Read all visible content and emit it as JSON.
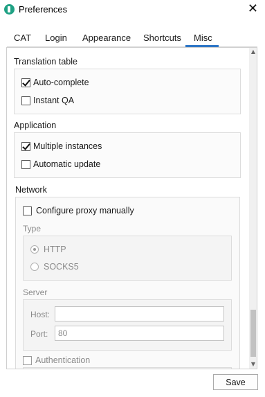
{
  "window": {
    "title": "Preferences",
    "close_glyph": "✕"
  },
  "tabs": [
    {
      "label": "CAT"
    },
    {
      "label": "Login"
    },
    {
      "label": "Appearance"
    },
    {
      "label": "Shortcuts"
    },
    {
      "label": "Misc",
      "active": true
    }
  ],
  "translation_table": {
    "title": "Translation table",
    "options": [
      {
        "label": "Auto-complete",
        "checked": true
      },
      {
        "label": "Instant QA",
        "checked": false
      }
    ]
  },
  "application": {
    "title": "Application",
    "options": [
      {
        "label": "Multiple instances",
        "checked": true
      },
      {
        "label": "Automatic update",
        "checked": false
      }
    ]
  },
  "network": {
    "title": "Network",
    "configure_proxy": {
      "label": "Configure proxy manually",
      "checked": false
    },
    "type": {
      "title": "Type",
      "options": [
        {
          "label": "HTTP",
          "selected": true
        },
        {
          "label": "SOCKS5",
          "selected": false
        }
      ]
    },
    "server": {
      "title": "Server",
      "host_label": "Host:",
      "host_value": "",
      "port_label": "Port:",
      "port_value": "80"
    },
    "authentication": {
      "label": "Authentication",
      "checked": false
    }
  },
  "footer": {
    "save_label": "Save"
  },
  "colors": {
    "accent": "#2e76c6",
    "app_icon": "#1fa184"
  }
}
